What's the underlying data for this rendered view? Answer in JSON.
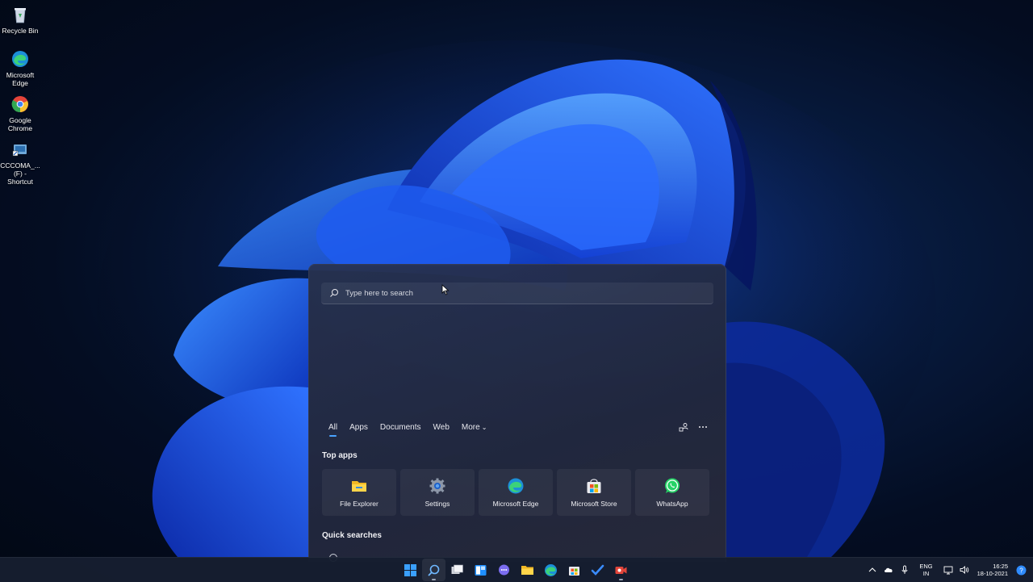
{
  "desktop": {
    "icons": [
      {
        "label": "Recycle Bin",
        "icon": "recycle-bin-icon"
      },
      {
        "label": "Microsoft Edge",
        "icon": "edge-icon"
      },
      {
        "label": "Google Chrome",
        "icon": "chrome-icon"
      },
      {
        "label": "CCCOMA_... (F) - Shortcut",
        "icon": "shortcut-icon"
      }
    ]
  },
  "search": {
    "placeholder": "Type here to search",
    "tabs": [
      {
        "label": "All",
        "active": true
      },
      {
        "label": "Apps"
      },
      {
        "label": "Documents"
      },
      {
        "label": "Web"
      },
      {
        "label": "More"
      }
    ],
    "top_apps_title": "Top apps",
    "top_apps": [
      {
        "label": "File Explorer",
        "icon": "file-explorer-icon"
      },
      {
        "label": "Settings",
        "icon": "settings-gear-icon"
      },
      {
        "label": "Microsoft Edge",
        "icon": "edge-icon"
      },
      {
        "label": "Microsoft Store",
        "icon": "store-icon"
      },
      {
        "label": "WhatsApp",
        "icon": "whatsapp-icon"
      }
    ],
    "quick_searches_title": "Quick searches"
  },
  "taskbar": {
    "apps": [
      "start-icon",
      "search-icon",
      "task-view-icon",
      "widgets-icon",
      "chat-icon",
      "file-explorer-icon",
      "edge-icon",
      "store-icon",
      "todo-icon",
      "camera-icon"
    ],
    "tray": {
      "lang_top": "ENG",
      "lang_bottom": "IN",
      "time": "16:25",
      "date": "18-10-2021"
    }
  },
  "colors": {
    "accent": "#4aa3ff",
    "taskbar": "#161e30"
  }
}
